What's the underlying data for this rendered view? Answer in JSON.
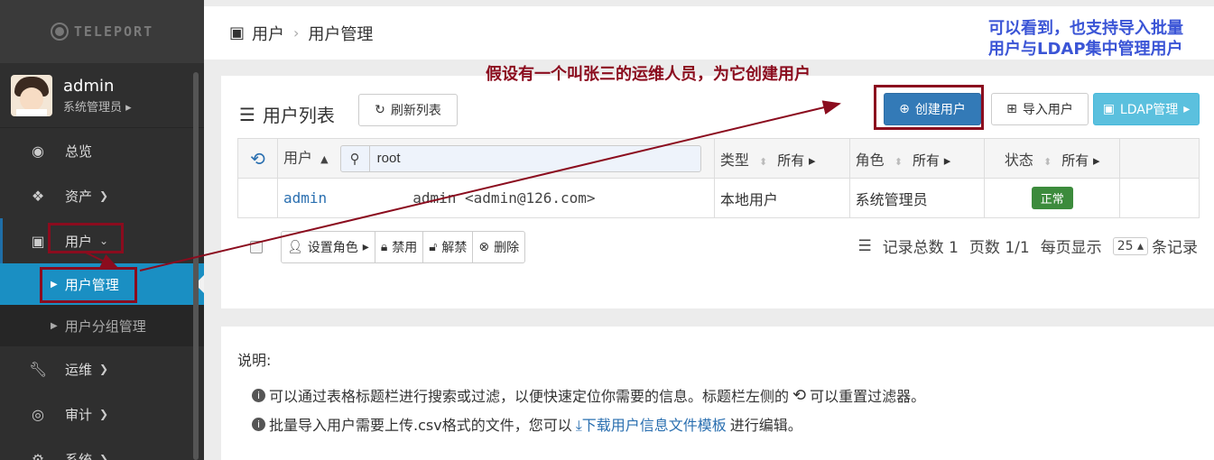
{
  "brand": {
    "logo_text": "TELEPORT"
  },
  "profile": {
    "name": "admin",
    "role": "系统管理员 ▸"
  },
  "nav": {
    "dashboard": "总览",
    "assets": "资产",
    "users": "用户",
    "user_manage": "用户管理",
    "user_group": "用户分组管理",
    "ops": "运维",
    "audit": "审计",
    "system": "系统"
  },
  "breadcrumb": {
    "root": "用户",
    "current": "用户管理"
  },
  "panel": {
    "title": "用户列表",
    "refresh_label": "刷新列表"
  },
  "toolbar": {
    "create_label": "创建用户",
    "import_label": "导入用户",
    "ldap_label": "LDAP管理"
  },
  "table": {
    "headers": {
      "user": "用户",
      "type": "类型",
      "role": "角色",
      "status": "状态",
      "filter_all": "所有"
    },
    "search_value": "root",
    "rows": [
      {
        "username": "admin",
        "email": "admin <admin@126.com>",
        "type": "本地用户",
        "role": "系统管理员",
        "status": "正常"
      }
    ]
  },
  "actions": {
    "set_role": "设置角色",
    "disable": "禁用",
    "unlock": "解禁",
    "delete": "删除"
  },
  "pager": {
    "total": "记录总数 1",
    "pages": "页数 1/1",
    "per_page_label": "每页显示",
    "per_page": "25",
    "unit": "条记录"
  },
  "help": {
    "title": "说明:",
    "line1_a": "可以通过表格标题栏进行搜索或过滤，以便快速定位你需要的信息。标题栏左侧的",
    "line1_b": "可以重置过滤器。",
    "line2_a": "批量导入用户需要上传.csv格式的文件，您可以",
    "line2_link": "下载用户信息文件模板",
    "line2_b": "进行编辑。"
  },
  "annotations": {
    "main": "假设有一个叫张三的运维人员，为它创建用户",
    "side": "可以看到，也支持导入批量用户与LDAP集中管理用户"
  }
}
